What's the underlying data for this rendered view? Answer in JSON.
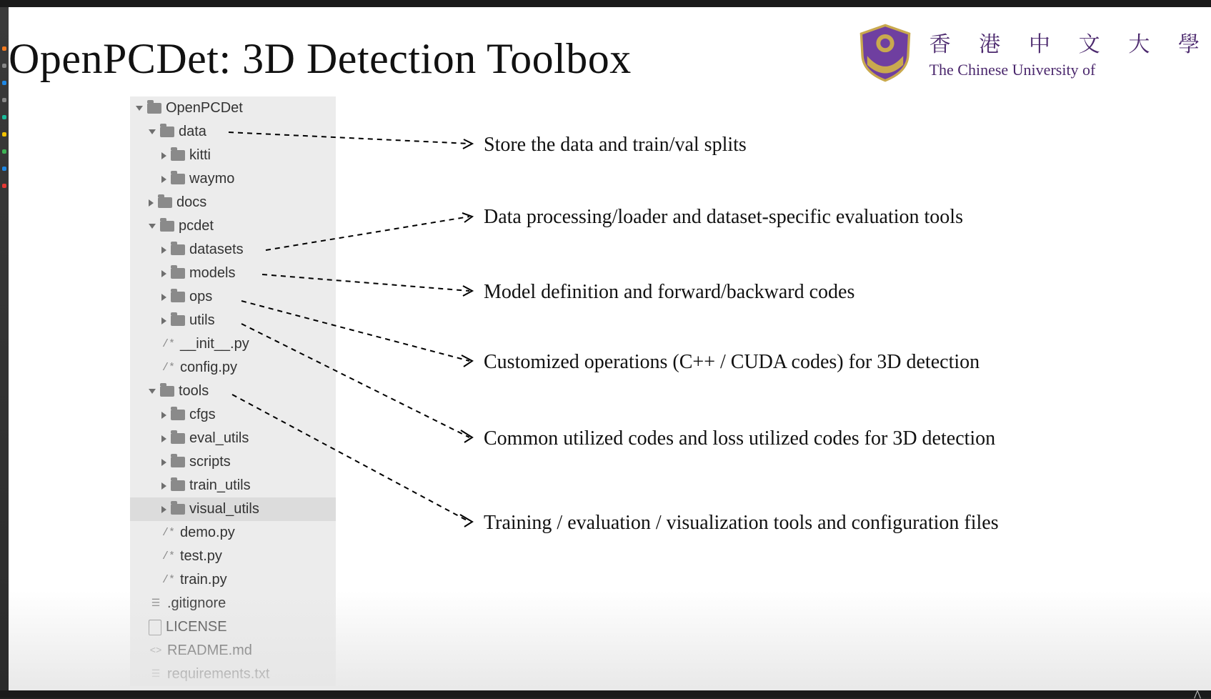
{
  "top_bar": {},
  "slide": {
    "title": "OpenPCDet: 3D Detection Toolbox",
    "university": {
      "cn": "香 港 中 文 大 學",
      "en": "The Chinese University of"
    }
  },
  "tree": {
    "root": "OpenPCDet",
    "items": [
      {
        "label": "data",
        "kind": "folder",
        "level": 1,
        "open": true
      },
      {
        "label": "kitti",
        "kind": "folder",
        "level": 2,
        "open": false
      },
      {
        "label": "waymo",
        "kind": "folder",
        "level": 2,
        "open": false
      },
      {
        "label": "docs",
        "kind": "folder",
        "level": 1,
        "open": false
      },
      {
        "label": "pcdet",
        "kind": "folder",
        "level": 1,
        "open": true
      },
      {
        "label": "datasets",
        "kind": "folder",
        "level": 2,
        "open": false
      },
      {
        "label": "models",
        "kind": "folder",
        "level": 2,
        "open": false
      },
      {
        "label": "ops",
        "kind": "folder",
        "level": 2,
        "open": false
      },
      {
        "label": "utils",
        "kind": "folder",
        "level": 2,
        "open": false
      },
      {
        "label": "__init__.py",
        "kind": "py",
        "level": 2
      },
      {
        "label": "config.py",
        "kind": "py",
        "level": 2
      },
      {
        "label": "tools",
        "kind": "folder",
        "level": 1,
        "open": true
      },
      {
        "label": "cfgs",
        "kind": "folder",
        "level": 2,
        "open": false
      },
      {
        "label": "eval_utils",
        "kind": "folder",
        "level": 2,
        "open": false
      },
      {
        "label": "scripts",
        "kind": "folder",
        "level": 2,
        "open": false
      },
      {
        "label": "train_utils",
        "kind": "folder",
        "level": 2,
        "open": false
      },
      {
        "label": "visual_utils",
        "kind": "folder",
        "level": 2,
        "open": false,
        "selected": true
      },
      {
        "label": "demo.py",
        "kind": "py",
        "level": 2
      },
      {
        "label": "test.py",
        "kind": "py",
        "level": 2
      },
      {
        "label": "train.py",
        "kind": "py",
        "level": 2
      },
      {
        "label": ".gitignore",
        "kind": "gi",
        "level": 1
      },
      {
        "label": "LICENSE",
        "kind": "file",
        "level": 1
      },
      {
        "label": "README.md",
        "kind": "md",
        "level": 1
      },
      {
        "label": "requirements.txt",
        "kind": "txt",
        "level": 1
      }
    ]
  },
  "annotations": [
    "Store the data and train/val splits",
    "Data processing/loader and dataset-specific evaluation tools",
    "Model definition and forward/backward codes",
    "Customized operations (C++ / CUDA codes) for 3D detection",
    "Common utilized codes and loss utilized codes for 3D detection",
    "Training / evaluation / visualization tools and configuration files"
  ],
  "bottom_bar": {
    "corner": "⋀"
  }
}
